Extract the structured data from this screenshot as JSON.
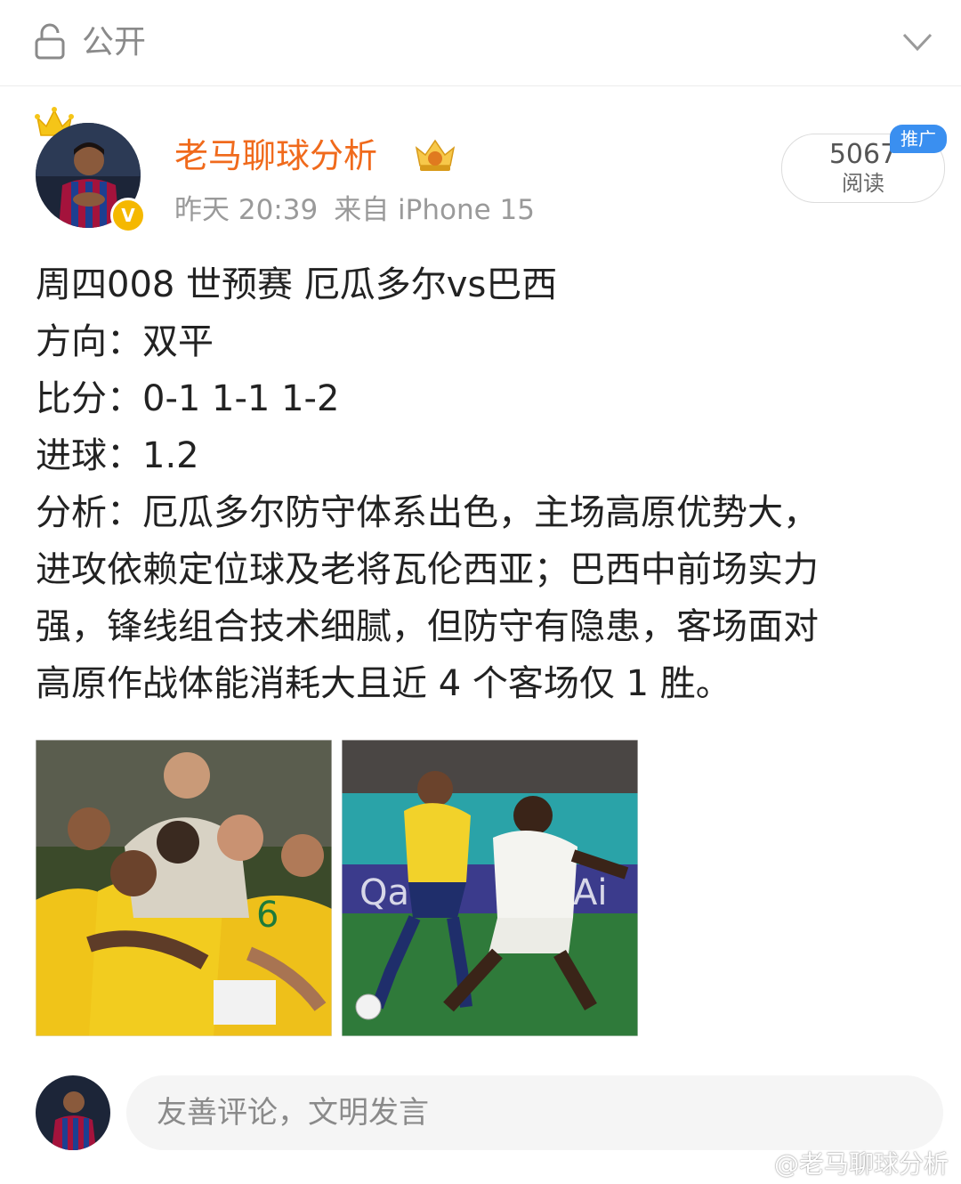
{
  "header": {
    "visibility_label": "公开"
  },
  "post": {
    "author_name": "老马聊球分析",
    "timestamp": "昨天 20:39",
    "source": "来自 iPhone 15",
    "read_count": "5067",
    "read_label": "阅读",
    "promo_tag": "推广",
    "lines": {
      "title": "周四008 世预赛 厄瓜多尔vs巴西",
      "direction": "方向：双平",
      "score": "比分：0-1 1-1 1-2",
      "goals": "进球：1.2",
      "analysis_1": "分析：厄瓜多尔防守体系出色，主场高原优势大，",
      "analysis_2": "进攻依赖定位球及老将瓦伦西亚；巴西中前场实力",
      "analysis_3": "强，锋线组合技术细腻，但防守有隐患，客场面对",
      "analysis_4": "高原作战体能消耗大且近 4 个客场仅 1 胜。"
    },
    "images": [
      {
        "name": "brazil-celebration-photo"
      },
      {
        "name": "ecuador-vs-senegal-photo"
      }
    ]
  },
  "comment": {
    "placeholder": "友善评论，文明发言"
  },
  "watermark": "@老马聊球分析",
  "colors": {
    "author": "#f06a1c",
    "promo": "#3a8ff0",
    "verified": "#f5b800"
  }
}
